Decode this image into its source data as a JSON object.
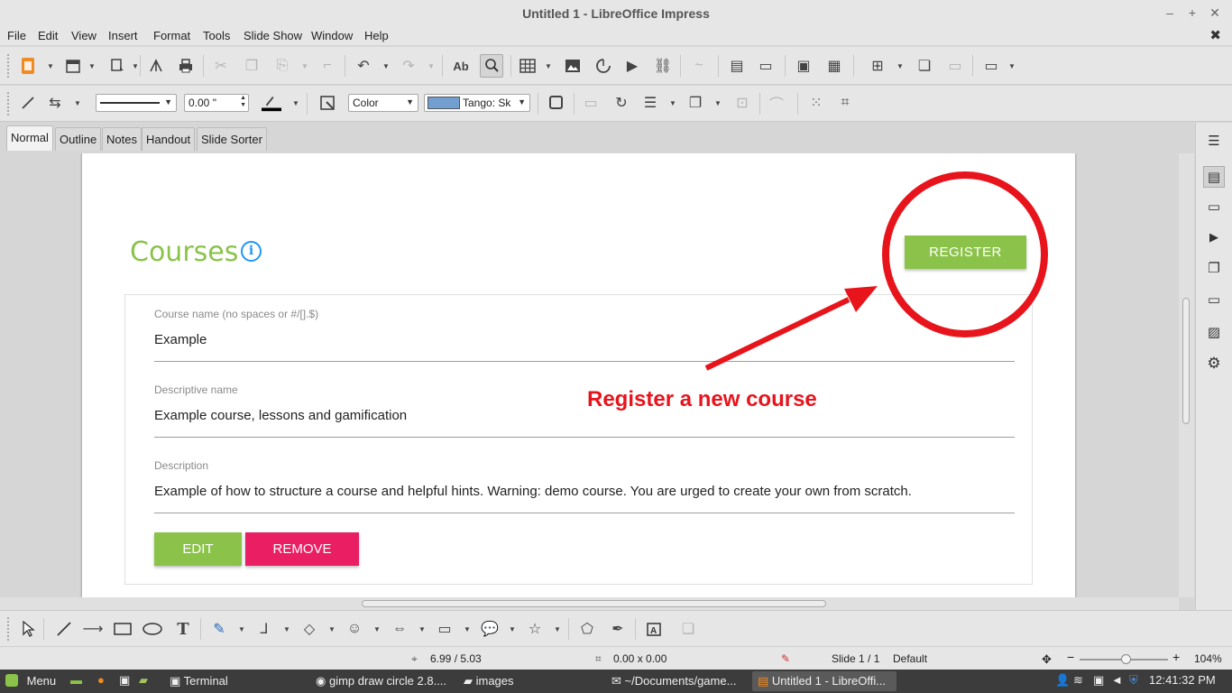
{
  "window": {
    "title": "Untitled 1 - LibreOffice Impress",
    "minimize_glyph": "‒",
    "maximize_glyph": "+",
    "close_glyph": "✕"
  },
  "menu": {
    "items": [
      "File",
      "Edit",
      "View",
      "Insert",
      "Format",
      "Tools",
      "Slide Show",
      "Window",
      "Help"
    ],
    "close_doc_glyph": "✖"
  },
  "toolbar2": {
    "line_width_value": "0.00 \"",
    "area_style": "Color",
    "fill_color_name": "Tango: Sk",
    "fill_color_hex": "#729fcf"
  },
  "view_tabs": [
    "Normal",
    "Outline",
    "Notes",
    "Handout",
    "Slide Sorter"
  ],
  "slide": {
    "heading": "Courses",
    "info_glyph": "i",
    "register_button": "REGISTER",
    "fields": [
      {
        "label": "Course name (no spaces or #/[].$)",
        "value": "Example"
      },
      {
        "label": "Descriptive name",
        "value": "Example course, lessons and gamification"
      },
      {
        "label": "Description",
        "value": "Example of how to structure a course and helpful hints. Warning: demo course. You are urged to create your own from scratch."
      }
    ],
    "edit_button": "EDIT",
    "remove_button": "REMOVE",
    "annotation_text": "Register a new course",
    "colors": {
      "accent_green": "#8bc34a",
      "remove_pink": "#e91e63",
      "annotation_red": "#e8141c",
      "info_blue": "#2196f3"
    }
  },
  "statusbar": {
    "position": "6.99 / 5.03",
    "size": "0.00 x 0.00",
    "slide_indicator": "Slide 1 / 1",
    "master": "Default",
    "zoom": "104%",
    "zoom_level": 0.52
  },
  "taskbar": {
    "menu_label": "Menu",
    "tasks": [
      "Terminal",
      "gimp draw circle 2.8....",
      "images",
      "~/Documents/game...",
      "Untitled 1 - LibreOffi..."
    ],
    "clock": "12:41:32 PM"
  }
}
